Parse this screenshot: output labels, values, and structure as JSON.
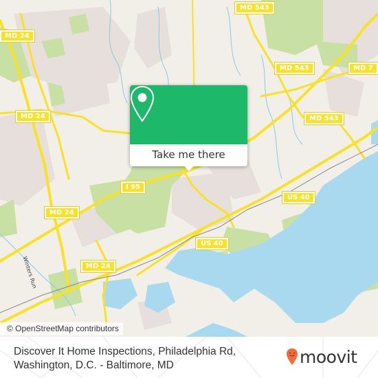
{
  "map": {
    "attribution": "© OpenStreetMap contributors",
    "road_shields": [
      {
        "label": "MD 543",
        "id": "md543-top"
      },
      {
        "label": "MD 543",
        "id": "md543-mid"
      },
      {
        "label": "MD 7",
        "id": "md7"
      },
      {
        "label": "MD 543",
        "id": "md543-right"
      },
      {
        "label": "MD 24",
        "id": "md24-top-left"
      },
      {
        "label": "MD 24",
        "id": "md24-left"
      },
      {
        "label": "MD 24",
        "id": "md24-mid"
      },
      {
        "label": "MD 24",
        "id": "md24-bottom"
      },
      {
        "label": "I 95",
        "id": "i95"
      },
      {
        "label": "US 40",
        "id": "us40-right"
      },
      {
        "label": "US 40",
        "id": "us40-mid"
      }
    ],
    "waterway_label": "Winters Run",
    "colors": {
      "land": "#f2efe9",
      "residential": "#e6dfdc",
      "park": "#c8e0a4",
      "water": "#a8d9ee",
      "road": "#f7e227",
      "rail": "#888888"
    }
  },
  "popup": {
    "icon": "map-pin-icon",
    "cta_label": "Take me there",
    "accent_color": "#1eb86b"
  },
  "footer": {
    "address_line1": "Discover It Home Inspections, Philadelphia Rd,",
    "address_line2": "Washington, D.C. - Baltimore, MD",
    "brand": "moovit",
    "brand_color": "#f26b3a"
  }
}
